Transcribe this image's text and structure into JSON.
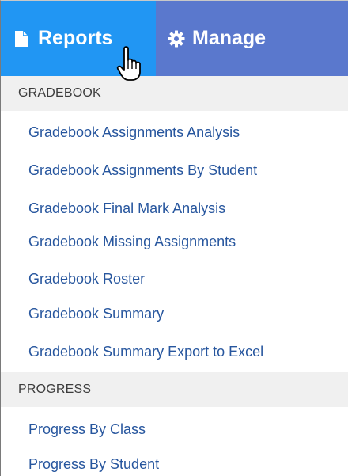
{
  "nav": {
    "tabs": [
      {
        "label": "Reports",
        "icon": "document-icon",
        "active": true
      },
      {
        "label": "Manage",
        "icon": "gear-icon",
        "active": false
      }
    ]
  },
  "sections": [
    {
      "header": "GRADEBOOK",
      "items": [
        "Gradebook Assignments Analysis",
        "Gradebook Assignments By Student",
        "Gradebook Final Mark Analysis",
        "Gradebook Missing Assignments",
        "Gradebook Roster",
        "Gradebook Summary",
        "Gradebook Summary Export to Excel"
      ]
    },
    {
      "header": "PROGRESS",
      "items": [
        "Progress By Class",
        "Progress By Student"
      ]
    }
  ],
  "colors": {
    "topbar": "#5a78cd",
    "active_tab": "#2196f3",
    "link": "#27569e",
    "section_bg": "#f0f0f0"
  }
}
